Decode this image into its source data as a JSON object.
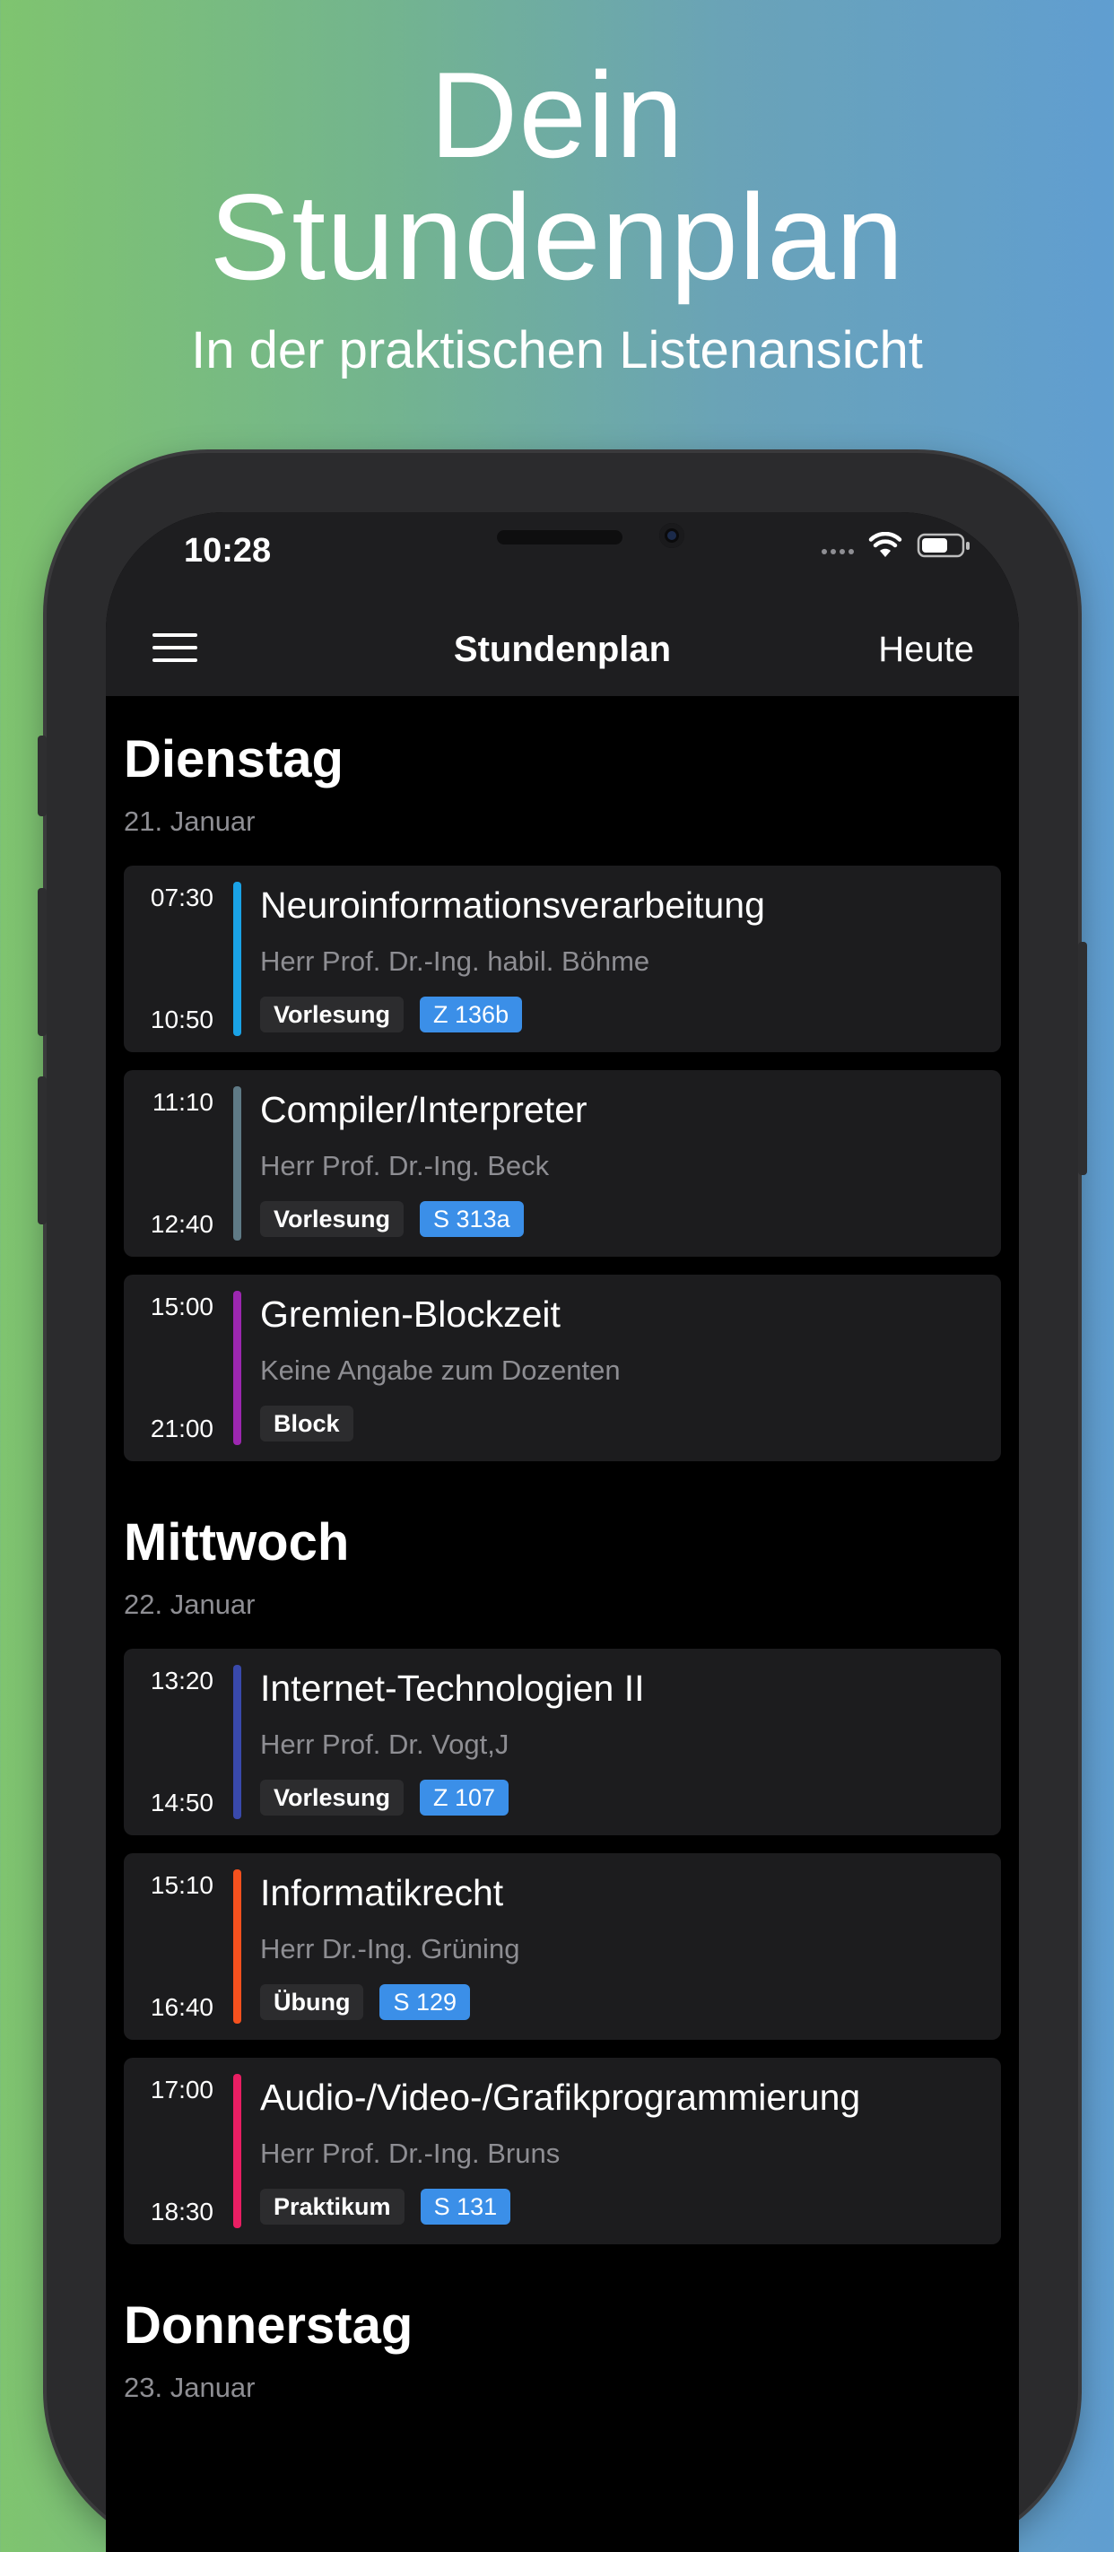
{
  "hero": {
    "title_line1": "Dein",
    "title_line2": "Stundenplan",
    "subtitle": "In der praktischen Listenansicht"
  },
  "status_bar": {
    "time": "10:28",
    "icons": [
      "signal-dots-icon",
      "wifi-icon",
      "battery-icon"
    ]
  },
  "nav": {
    "menu_icon": "hamburger-menu-icon",
    "title": "Stundenplan",
    "today_label": "Heute"
  },
  "colors": {
    "gradient_left": "#7fc46f",
    "gradient_right": "#609ed1",
    "room_tag": "#3b8fe8",
    "card_bg": "#1c1c1e"
  },
  "days": [
    {
      "name": "Dienstag",
      "date": "21. Januar",
      "lessons": [
        {
          "start": "07:30",
          "end": "10:50",
          "title": "Neuroinformationsverarbeitung",
          "lecturer": "Herr Prof. Dr.-Ing. habil. Böhme",
          "type": "Vorlesung",
          "room": "Z 136b",
          "color": "#1aa2e6"
        },
        {
          "start": "11:10",
          "end": "12:40",
          "title": "Compiler/Interpreter",
          "lecturer": "Herr Prof. Dr.-Ing. Beck",
          "type": "Vorlesung",
          "room": "S 313a",
          "color": "#5f7a86"
        },
        {
          "start": "15:00",
          "end": "21:00",
          "title": "Gremien-Blockzeit",
          "lecturer": "Keine Angabe zum Dozenten",
          "type": "Block",
          "room": "",
          "color": "#9c27b0"
        }
      ]
    },
    {
      "name": "Mittwoch",
      "date": "22. Januar",
      "lessons": [
        {
          "start": "13:20",
          "end": "14:50",
          "title": "Internet-Technologien II",
          "lecturer": "Herr Prof. Dr. Vogt,J",
          "type": "Vorlesung",
          "room": "Z 107",
          "color": "#3949ab"
        },
        {
          "start": "15:10",
          "end": "16:40",
          "title": "Informatikrecht",
          "lecturer": "Herr Dr.-Ing. Grüning",
          "type": "Übung",
          "room": "S 129",
          "color": "#f4511e"
        },
        {
          "start": "17:00",
          "end": "18:30",
          "title": "Audio-/Video-/Grafikprogrammierung",
          "lecturer": "Herr Prof. Dr.-Ing. Bruns",
          "type": "Praktikum",
          "room": "S 131",
          "color": "#e91e63"
        }
      ]
    },
    {
      "name": "Donnerstag",
      "date": "23. Januar",
      "lessons": []
    }
  ]
}
